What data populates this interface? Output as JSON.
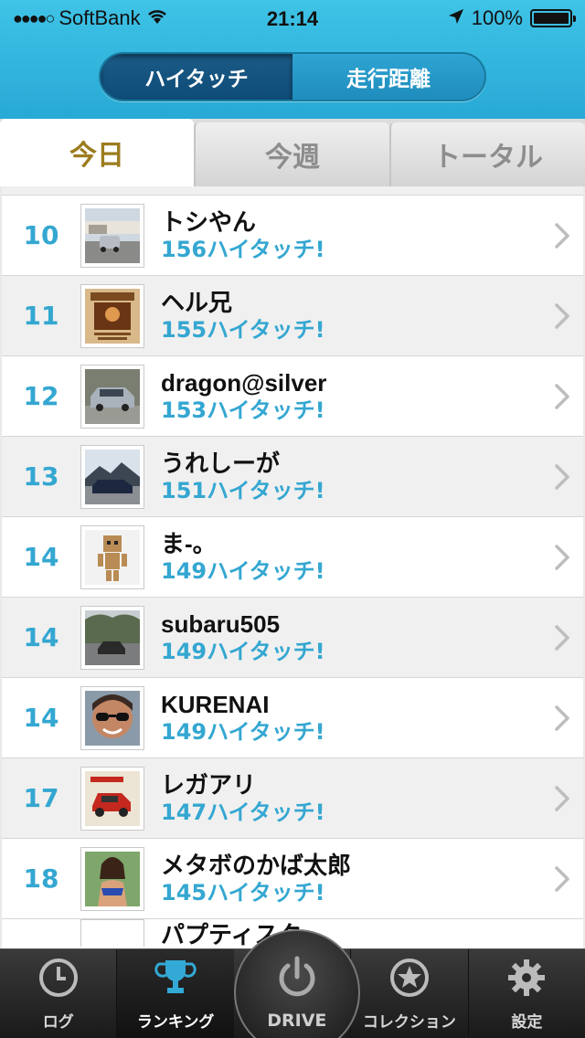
{
  "status_bar": {
    "signal": "●●●●○",
    "carrier": "SoftBank",
    "time": "21:14",
    "battery": "100%"
  },
  "header": {
    "segments": [
      "ハイタッチ",
      "走行距離"
    ],
    "selected_segment": 0
  },
  "tabs": [
    {
      "label": "今日",
      "active": true
    },
    {
      "label": "今週",
      "active": false
    },
    {
      "label": "トータル",
      "active": false
    }
  ],
  "ranking": [
    {
      "rank": "10",
      "name": "トシやん",
      "score": "156ハイタッチ!",
      "thumb": "car-parking"
    },
    {
      "rank": "11",
      "name": "ヘル兄",
      "score": "155ハイタッチ!",
      "thumb": "wanted-poster"
    },
    {
      "rank": "12",
      "name": "dragon@silver",
      "score": "153ハイタッチ!",
      "thumb": "silver-car"
    },
    {
      "rank": "13",
      "name": "うれしーが",
      "score": "151ハイタッチ!",
      "thumb": "car-mountain"
    },
    {
      "rank": "14",
      "name": "ま-。",
      "score": "149ハイタッチ!",
      "thumb": "cardboard-robot"
    },
    {
      "rank": "14",
      "name": "subaru505",
      "score": "149ハイタッチ!",
      "thumb": "car-road"
    },
    {
      "rank": "14",
      "name": "KURENAI",
      "score": "149ハイタッチ!",
      "thumb": "man-sunglasses"
    },
    {
      "rank": "17",
      "name": "レガアリ",
      "score": "147ハイタッチ!",
      "thumb": "impul-march"
    },
    {
      "rank": "18",
      "name": "メタボのかば太郎",
      "score": "145ハイタッチ!",
      "thumb": "woman-photo"
    }
  ],
  "partial_next_name": "パプティスク",
  "tabbar": {
    "items": [
      {
        "label": "ログ",
        "icon": "clock-icon"
      },
      {
        "label": "ランキング",
        "icon": "trophy-icon",
        "active": true
      },
      {
        "label": "DRIVE",
        "icon": "power-icon"
      },
      {
        "label": "コレクション",
        "icon": "star-icon"
      },
      {
        "label": "設定",
        "icon": "gear-icon"
      }
    ]
  },
  "colors": {
    "header": "#32b6df",
    "accent_blue": "#34a7d1",
    "active_tab_text": "#9c7c20"
  }
}
